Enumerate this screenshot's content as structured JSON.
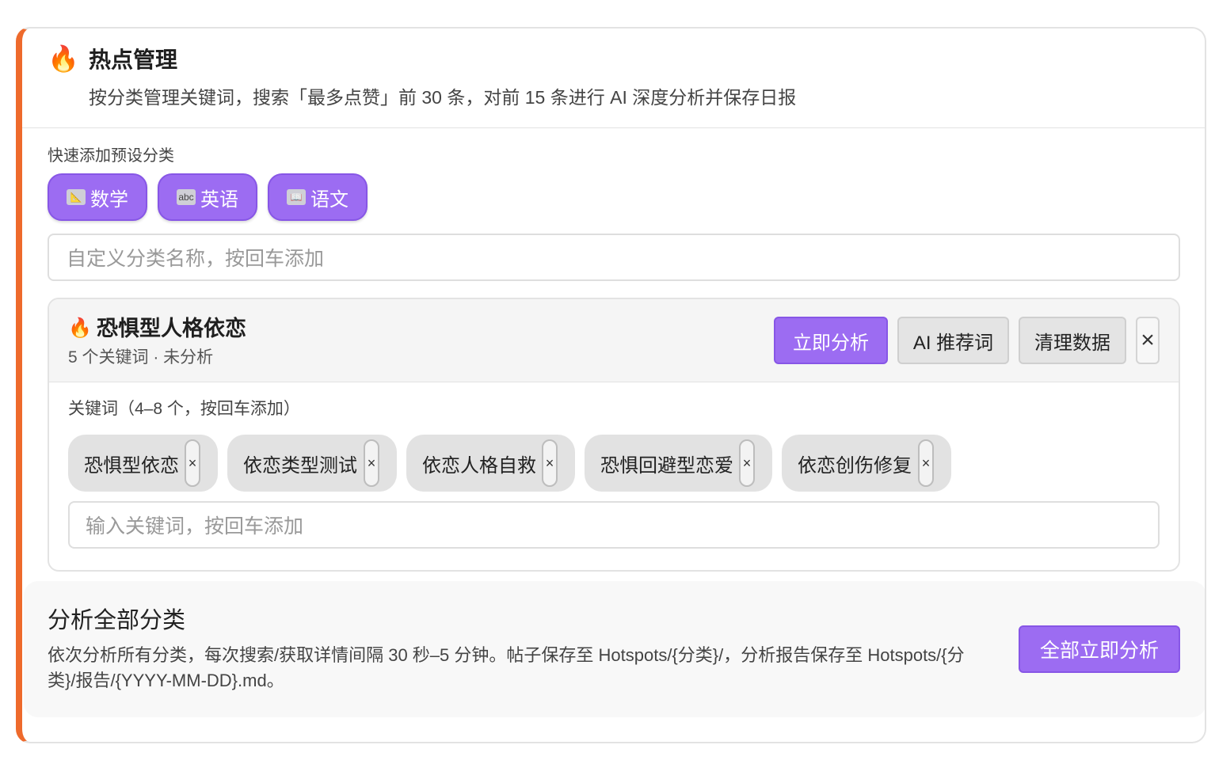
{
  "header": {
    "icon": "fire-icon",
    "title": "热点管理",
    "subtitle": "按分类管理关键词，搜索「最多点赞」前 30 条，对前 15 条进行 AI 深度分析并保存日报"
  },
  "presets": {
    "label": "快速添加预设分类",
    "items": [
      {
        "icon": "ruler-icon",
        "label": "数学"
      },
      {
        "icon": "abc-icon",
        "label": "英语"
      },
      {
        "icon": "book-icon",
        "label": "语文"
      }
    ]
  },
  "custom_input": {
    "placeholder": "自定义分类名称，按回车添加"
  },
  "category": {
    "icon": "fire-icon",
    "title": "恐惧型人格依恋",
    "meta": "5 个关键词 · 未分析",
    "buttons": {
      "analyze": "立即分析",
      "recommend": "AI 推荐词",
      "clear": "清理数据",
      "close": "×"
    },
    "keywords_label": "关键词（4–8 个，按回车添加）",
    "keywords": [
      "恐惧型依恋",
      "依恋类型测试",
      "依恋人格自救",
      "恐惧回避型恋爱",
      "依恋创伤修复"
    ],
    "keyword_input_placeholder": "输入关键词，按回车添加"
  },
  "analyze_all": {
    "title": "分析全部分类",
    "description": "依次分析所有分类，每次搜索/获取详情间隔 30 秒–5 分钟。帖子保存至 Hotspots/{分类}/，分析报告保存至 Hotspots/{分类}/报告/{YYYY-MM-DD}.md。",
    "button": "全部立即分析"
  },
  "colors": {
    "accent": "#9c6cf2",
    "left_bar": "#ee6a2c"
  }
}
